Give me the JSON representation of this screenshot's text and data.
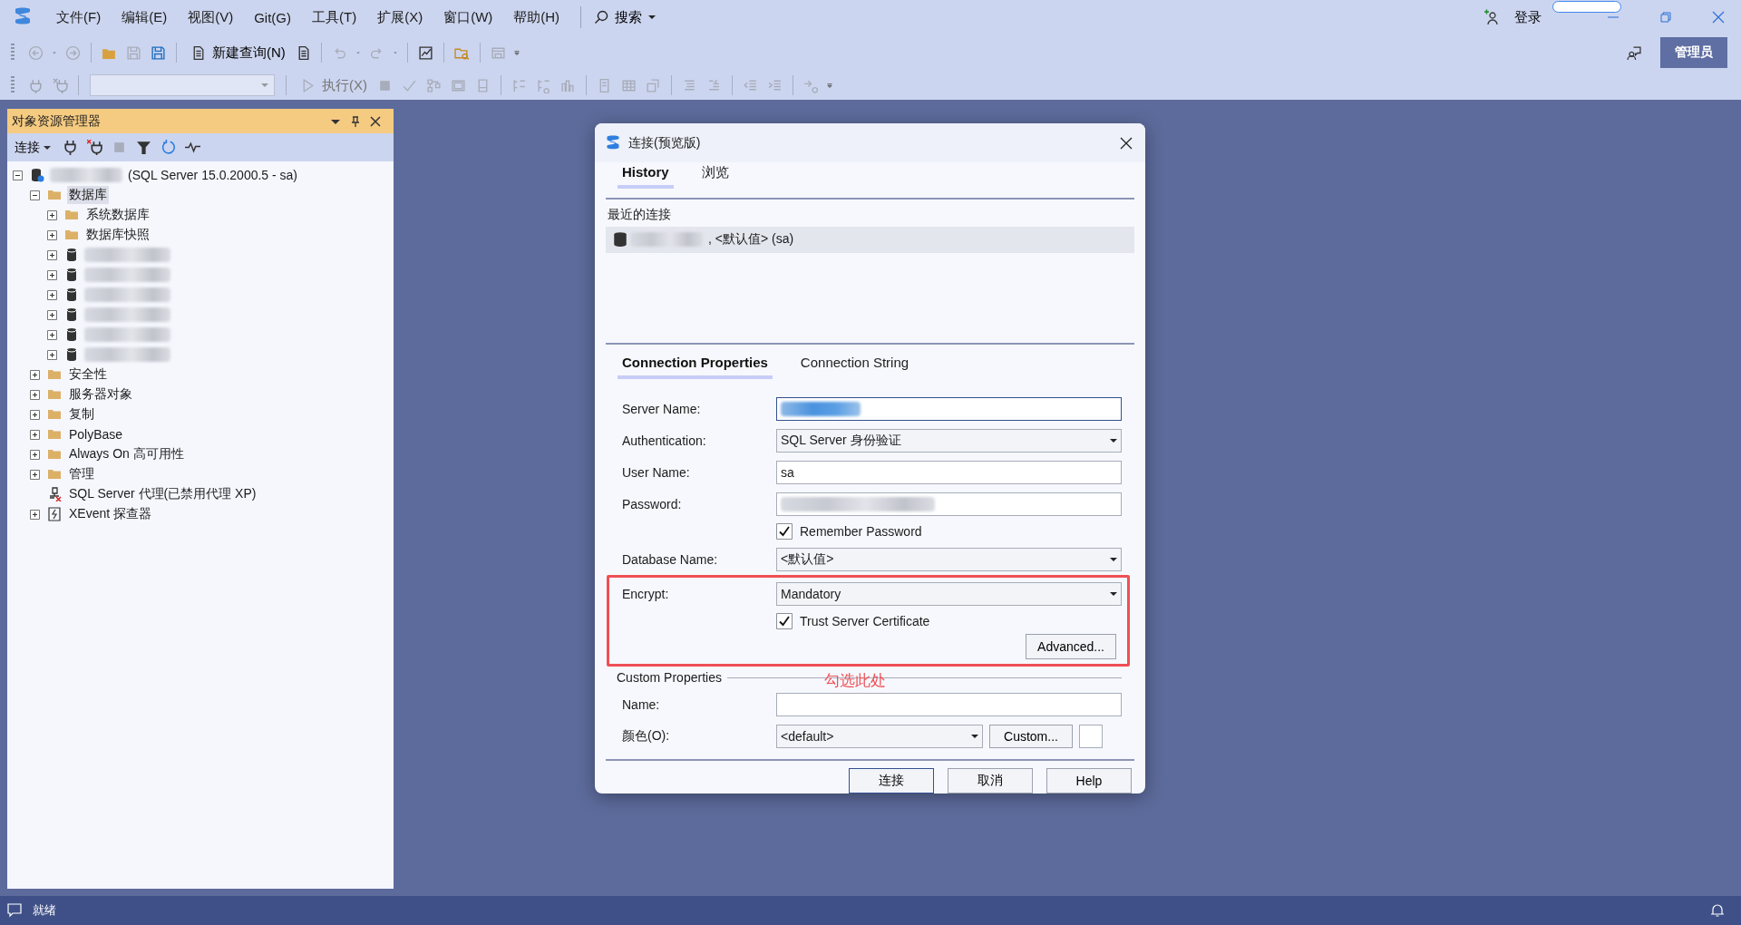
{
  "app": {
    "menu": [
      "文件(F)",
      "编辑(E)",
      "视图(V)",
      "Git(G)",
      "工具(T)",
      "扩展(X)",
      "窗口(W)",
      "帮助(H)"
    ],
    "search": "搜索",
    "login": "登录",
    "admin": "管理员"
  },
  "toolbar": {
    "new_query": "新建查询(N)",
    "execute": "执行(X)",
    "execute_disabled": true
  },
  "object_explorer": {
    "title": "对象资源管理器",
    "connect": "连接",
    "tree": [
      {
        "kind": "server",
        "redacted": true,
        "label": "(SQL Server 15.0.2000.5 - sa)",
        "expanded": true,
        "children": [
          {
            "kind": "folder",
            "label": "数据库",
            "expanded": true,
            "selected": true,
            "children": [
              {
                "kind": "folder",
                "label": "系统数据库",
                "expanded": false,
                "selected": false
              },
              {
                "kind": "folder",
                "label": "数据库快照",
                "expanded": false,
                "selected": false
              },
              {
                "kind": "database",
                "redacted": true,
                "expanded": false,
                "selected": false
              },
              {
                "kind": "database",
                "redacted": true,
                "expanded": false,
                "selected": false
              },
              {
                "kind": "database",
                "redacted": true,
                "expanded": false,
                "selected": false
              },
              {
                "kind": "database",
                "redacted": true,
                "expanded": false,
                "selected": false
              },
              {
                "kind": "database",
                "redacted": true,
                "expanded": false,
                "selected": false
              },
              {
                "kind": "database",
                "redacted": true,
                "expanded": false,
                "selected": false
              }
            ]
          },
          {
            "kind": "folder",
            "label": "安全性",
            "expanded": false,
            "selected": false
          },
          {
            "kind": "folder",
            "label": "服务器对象",
            "expanded": false,
            "selected": false
          },
          {
            "kind": "folder",
            "label": "复制",
            "expanded": false,
            "selected": false
          },
          {
            "kind": "folder",
            "label": "PolyBase",
            "expanded": false,
            "selected": false
          },
          {
            "kind": "folder",
            "label": "Always On 高可用性",
            "expanded": false,
            "selected": false
          },
          {
            "kind": "folder",
            "label": "管理",
            "expanded": false,
            "selected": false
          },
          {
            "kind": "agent",
            "label": "SQL Server 代理(已禁用代理 XP)",
            "selected": false
          },
          {
            "kind": "xevent",
            "label": "XEvent 探查器",
            "expanded": false,
            "selected": false
          }
        ]
      }
    ]
  },
  "dialog": {
    "title": "连接(预览版)",
    "tabs": [
      {
        "label": "History",
        "selected": true
      },
      {
        "label": "浏览",
        "selected": false
      }
    ],
    "recent_heading": "最近的连接",
    "recent": [
      {
        "redacted": true,
        "label": ", <默认值> (sa)",
        "selected": true
      }
    ],
    "property_tabs": [
      {
        "label": "Connection Properties",
        "selected": true
      },
      {
        "label": "Connection String",
        "selected": false
      }
    ],
    "fields": [
      {
        "kind": "text",
        "label": "Server Name:",
        "redacted": true,
        "focused": true
      },
      {
        "kind": "select",
        "label": "Authentication:",
        "value": "SQL Server 身份验证"
      },
      {
        "kind": "text",
        "label": "User Name:",
        "value": "sa"
      },
      {
        "kind": "text",
        "label": "Password:",
        "redacted": true
      },
      {
        "kind": "checkbox",
        "label": "Remember Password",
        "checked": true
      },
      {
        "kind": "select",
        "label": "Database Name:",
        "value": "<默认值>"
      },
      {
        "kind": "select",
        "label": "Encrypt:",
        "value": "Mandatory",
        "highlighted": true
      },
      {
        "kind": "checkbox",
        "label": "Trust Server Certificate",
        "checked": true,
        "highlighted": true
      },
      {
        "kind": "button",
        "label": "Advanced...",
        "highlighted": true
      }
    ],
    "custom_properties": {
      "title": "Custom Properties",
      "name_label": "Name:",
      "color_label": "颜色(O):",
      "color_value": "<default>",
      "custom_button": "Custom..."
    },
    "buttons": [
      {
        "label": "连接",
        "default": true
      },
      {
        "label": "取消",
        "default": false
      },
      {
        "label": "Help",
        "default": false
      }
    ],
    "annotation": "勾选此处"
  },
  "status_bar": {
    "text": "就绪"
  }
}
